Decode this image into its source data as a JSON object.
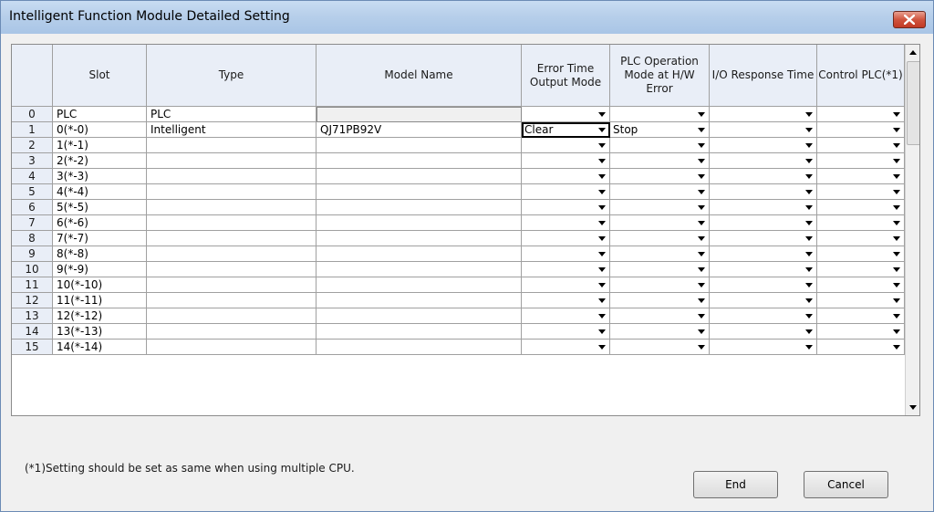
{
  "window": {
    "title": "Intelligent Function Module Detailed Setting"
  },
  "headers": {
    "slot": "Slot",
    "type": "Type",
    "model": "Model Name",
    "error_time": "Error Time Output Mode",
    "plc_op": "PLC Operation Mode at H/W Error",
    "io_resp": "I/O Response Time",
    "control": "Control PLC(*1)"
  },
  "rows": [
    {
      "no": "0",
      "slot": "PLC",
      "type": "PLC",
      "model": "",
      "err": "",
      "plc": "",
      "io": "",
      "ctrl": ""
    },
    {
      "no": "1",
      "slot": "0(*-0)",
      "type": "Intelligent",
      "model": "QJ71PB92V",
      "err": "Clear",
      "plc": "Stop",
      "io": "",
      "ctrl": ""
    },
    {
      "no": "2",
      "slot": "1(*-1)",
      "type": "",
      "model": "",
      "err": "",
      "plc": "",
      "io": "",
      "ctrl": ""
    },
    {
      "no": "3",
      "slot": "2(*-2)",
      "type": "",
      "model": "",
      "err": "",
      "plc": "",
      "io": "",
      "ctrl": ""
    },
    {
      "no": "4",
      "slot": "3(*-3)",
      "type": "",
      "model": "",
      "err": "",
      "plc": "",
      "io": "",
      "ctrl": ""
    },
    {
      "no": "5",
      "slot": "4(*-4)",
      "type": "",
      "model": "",
      "err": "",
      "plc": "",
      "io": "",
      "ctrl": ""
    },
    {
      "no": "6",
      "slot": "5(*-5)",
      "type": "",
      "model": "",
      "err": "",
      "plc": "",
      "io": "",
      "ctrl": ""
    },
    {
      "no": "7",
      "slot": "6(*-6)",
      "type": "",
      "model": "",
      "err": "",
      "plc": "",
      "io": "",
      "ctrl": ""
    },
    {
      "no": "8",
      "slot": "7(*-7)",
      "type": "",
      "model": "",
      "err": "",
      "plc": "",
      "io": "",
      "ctrl": ""
    },
    {
      "no": "9",
      "slot": "8(*-8)",
      "type": "",
      "model": "",
      "err": "",
      "plc": "",
      "io": "",
      "ctrl": ""
    },
    {
      "no": "10",
      "slot": "9(*-9)",
      "type": "",
      "model": "",
      "err": "",
      "plc": "",
      "io": "",
      "ctrl": ""
    },
    {
      "no": "11",
      "slot": "10(*-10)",
      "type": "",
      "model": "",
      "err": "",
      "plc": "",
      "io": "",
      "ctrl": ""
    },
    {
      "no": "12",
      "slot": "11(*-11)",
      "type": "",
      "model": "",
      "err": "",
      "plc": "",
      "io": "",
      "ctrl": ""
    },
    {
      "no": "13",
      "slot": "12(*-12)",
      "type": "",
      "model": "",
      "err": "",
      "plc": "",
      "io": "",
      "ctrl": ""
    },
    {
      "no": "14",
      "slot": "13(*-13)",
      "type": "",
      "model": "",
      "err": "",
      "plc": "",
      "io": "",
      "ctrl": ""
    },
    {
      "no": "15",
      "slot": "14(*-14)",
      "type": "",
      "model": "",
      "err": "",
      "plc": "",
      "io": "",
      "ctrl": ""
    }
  ],
  "footnote": "(*1)Setting should be set as same when using multiple CPU.",
  "buttons": {
    "end": "End",
    "cancel": "Cancel"
  },
  "icons": {
    "close": "close-icon",
    "dropdown": "chevron-down-icon"
  }
}
